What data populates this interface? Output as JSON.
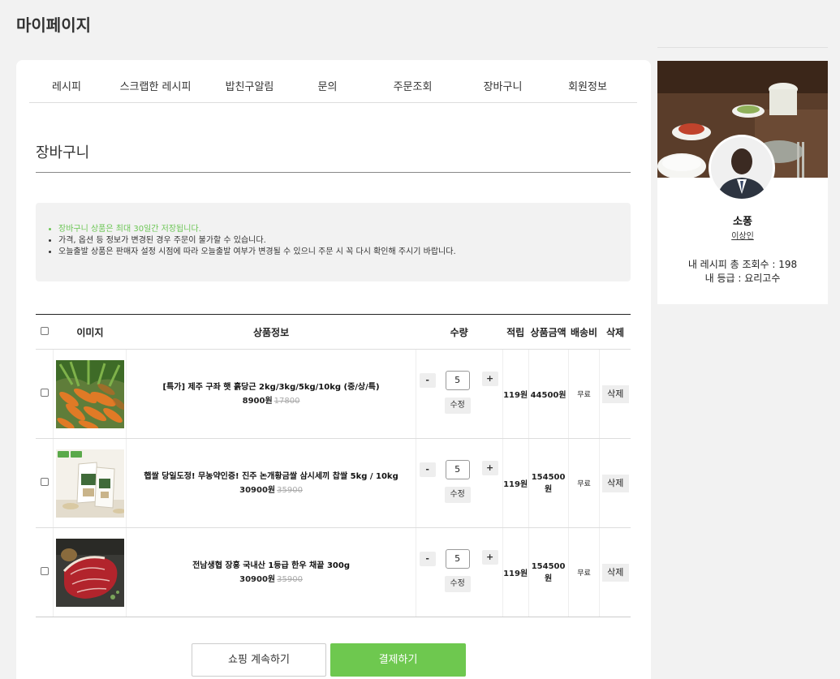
{
  "page_title": "마이페이지",
  "tabs": [
    "레시피",
    "스크랩한 레시피",
    "밥친구알림",
    "문의",
    "주문조회",
    "장바구니",
    "회원정보"
  ],
  "section_title": "장바구니",
  "notices": [
    "장바구니 상품은 최대 30일간 저장됩니다.",
    "가격, 옵션 등 정보가 변경된 경우 주문이 불가할 수 있습니다.",
    "오늘출발 상품은 판매자 설정 시점에 따라 오늘출발 여부가 변경될 수 있으니 주문 시 꼭 다시 확인해 주시기 바랍니다."
  ],
  "notice_colors": [
    "#6cc655",
    "#333333",
    "#333333"
  ],
  "table_headers": {
    "image": "이미지",
    "info": "상품정보",
    "qty": "수량",
    "points": "적립",
    "amount": "상품금액",
    "shipping": "배송비",
    "delete": "삭제"
  },
  "items": [
    {
      "name": "[특가] 제주 구좌 햇 흙당근 2kg/3kg/5kg/10kg (중/상/특)",
      "price": "8900원",
      "old_price": "17800",
      "quantity": "5",
      "points": "119원",
      "amount": "44500원",
      "shipping": "무료",
      "image": "carrots-photo"
    },
    {
      "name": "햅쌀 당일도정! 무농약인증! 진주 논개황금쌀 삼시세끼 찹쌀 5kg / 10kg",
      "price": "30900원",
      "old_price": "35900",
      "quantity": "5",
      "points": "119원",
      "amount": "154500원",
      "shipping": "무료",
      "image": "rice-bag-photo"
    },
    {
      "name": "전남생협 장흥 국내산 1등급 한우 채끝 300g",
      "price": "30900원",
      "old_price": "35900",
      "quantity": "5",
      "points": "119원",
      "amount": "154500원",
      "shipping": "무료",
      "image": "beef-photo"
    }
  ],
  "qty_controls": {
    "minus": "-",
    "plus": "+",
    "edit": "수정"
  },
  "delete_label": "삭제",
  "buttons": {
    "continue": "쇼핑 계속하기",
    "pay": "결제하기"
  },
  "profile": {
    "name": "소퐁",
    "link": "이상인",
    "views": "내 레시피 총 조회수 : 198",
    "grade": "내 등급 : 요리고수"
  },
  "colors": {
    "accent": "#6ec84f",
    "notice_green": "#6cc655"
  }
}
